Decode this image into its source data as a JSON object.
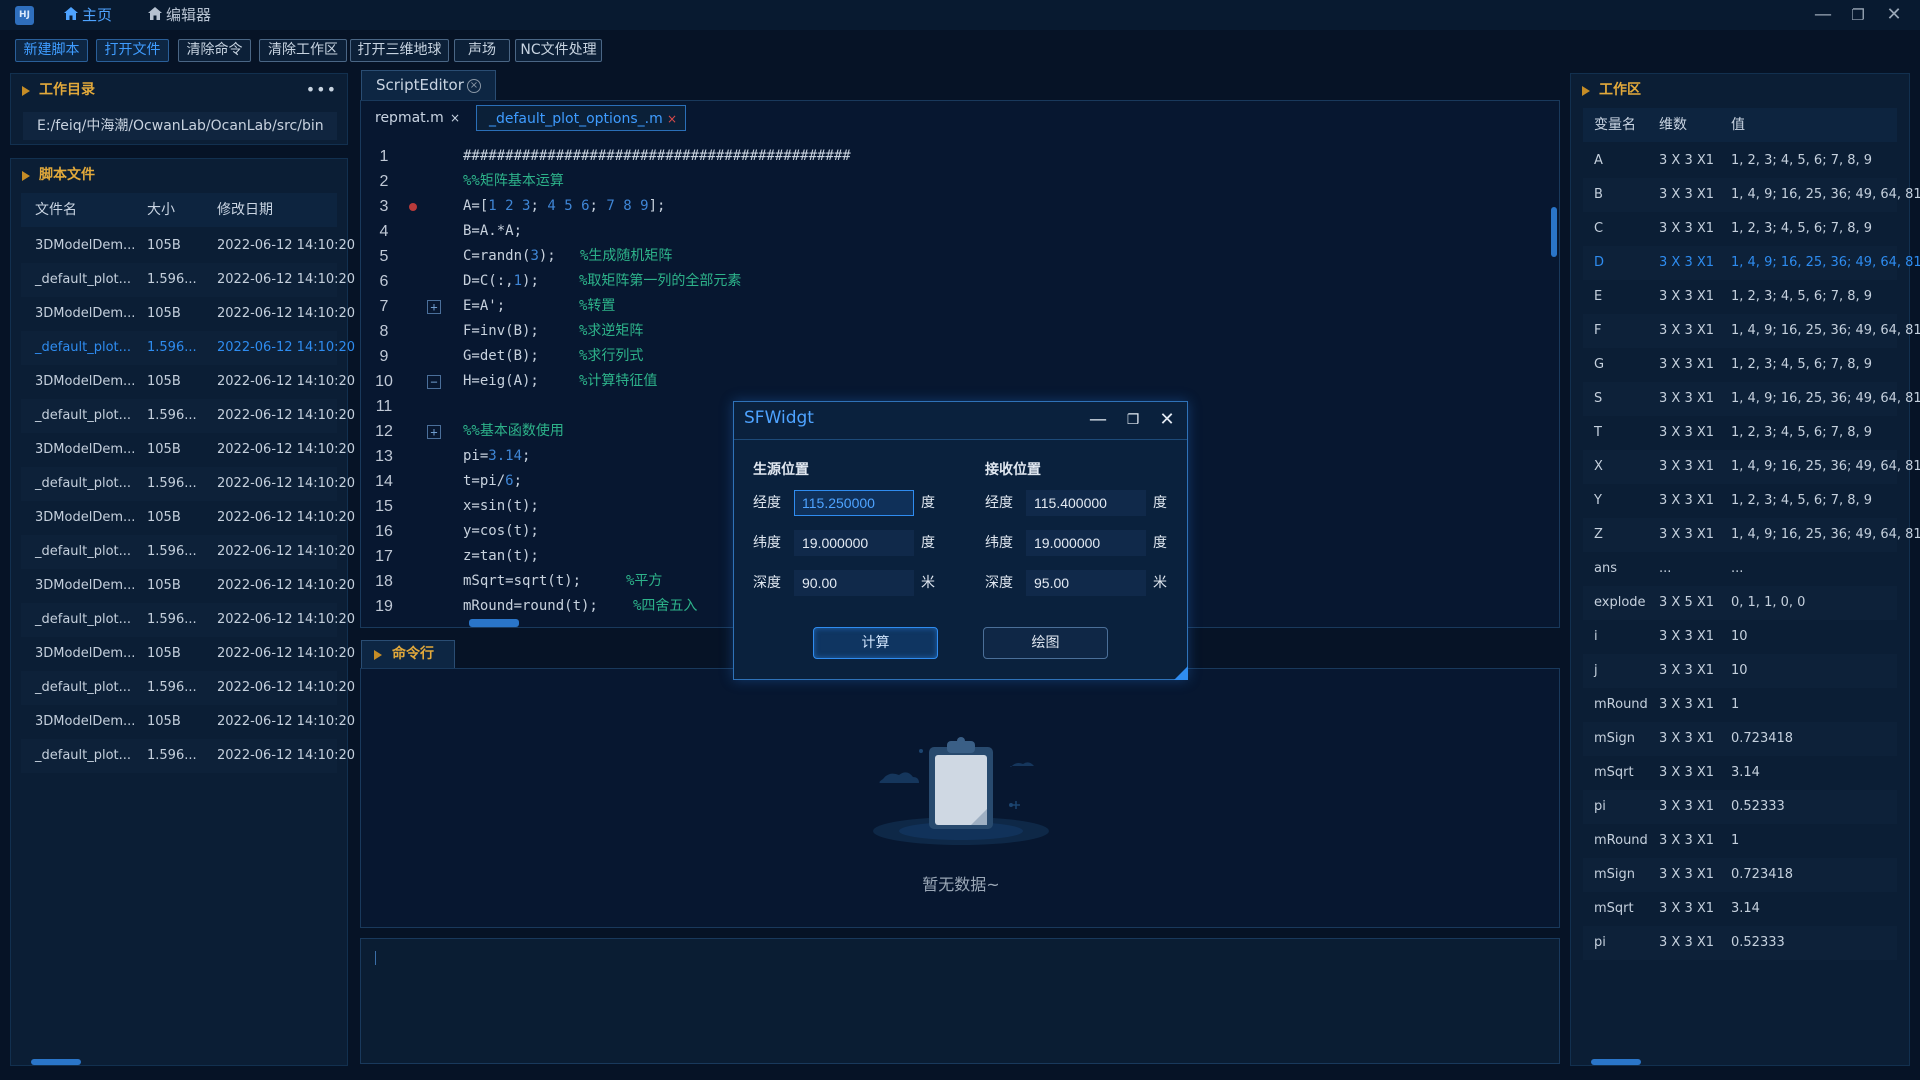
{
  "window": {
    "logo": "HJ",
    "tabs": [
      {
        "label": "主页",
        "icon": "home-icon"
      },
      {
        "label": "编辑器",
        "icon": "home-icon"
      }
    ],
    "controls": {
      "minimize": "—",
      "restore": "❐",
      "close": "✕"
    }
  },
  "toolbar": [
    {
      "label": "新建脚本",
      "primary": true
    },
    {
      "label": "打开文件",
      "primary": true
    },
    {
      "label": "清除命令",
      "primary": false
    },
    {
      "label": "清除工作区",
      "primary": false
    },
    {
      "label": "打开三维地球",
      "primary": false
    },
    {
      "label": "声场",
      "primary": false
    },
    {
      "label": "NC文件处理",
      "primary": false
    }
  ],
  "workdir": {
    "title": "工作目录",
    "path": "E:/feiq/中海潮/OcwanLab/OcanLab/src/bin",
    "more": "•••"
  },
  "scripts": {
    "title": "脚本文件",
    "columns": [
      "文件名",
      "大小",
      "修改日期"
    ],
    "rows": [
      {
        "name": "3DModelDem...",
        "size": "105B",
        "date": "2022-06-12 14:10:20"
      },
      {
        "name": "_default_plot...",
        "size": "1.596...",
        "date": "2022-06-12 14:10:20"
      },
      {
        "name": "3DModelDem...",
        "size": "105B",
        "date": "2022-06-12 14:10:20"
      },
      {
        "name": "_default_plot...",
        "size": "1.596...",
        "date": "2022-06-12 14:10:20"
      },
      {
        "name": "3DModelDem...",
        "size": "105B",
        "date": "2022-06-12 14:10:20"
      },
      {
        "name": "_default_plot...",
        "size": "1.596...",
        "date": "2022-06-12 14:10:20"
      },
      {
        "name": "3DModelDem...",
        "size": "105B",
        "date": "2022-06-12 14:10:20"
      },
      {
        "name": "_default_plot...",
        "size": "1.596...",
        "date": "2022-06-12 14:10:20"
      },
      {
        "name": "3DModelDem...",
        "size": "105B",
        "date": "2022-06-12 14:10:20"
      },
      {
        "name": "_default_plot...",
        "size": "1.596...",
        "date": "2022-06-12 14:10:20"
      },
      {
        "name": "3DModelDem...",
        "size": "105B",
        "date": "2022-06-12 14:10:20"
      },
      {
        "name": "_default_plot...",
        "size": "1.596...",
        "date": "2022-06-12 14:10:20"
      },
      {
        "name": "3DModelDem...",
        "size": "105B",
        "date": "2022-06-12 14:10:20"
      },
      {
        "name": "_default_plot...",
        "size": "1.596...",
        "date": "2022-06-12 14:10:20"
      },
      {
        "name": "3DModelDem...",
        "size": "105B",
        "date": "2022-06-12 14:10:20"
      },
      {
        "name": "_default_plot...",
        "size": "1.596...",
        "date": "2022-06-12 14:10:20"
      }
    ],
    "selected_index": 3
  },
  "editor": {
    "tab_label": "ScriptEditor",
    "files": [
      {
        "label": "repmat.m",
        "close": "×",
        "active": false
      },
      {
        "label": "_default_plot_options_.m",
        "close": "×",
        "active": true
      }
    ],
    "lines": [
      {
        "n": "1",
        "code": "##############################################",
        "comment": "",
        "gutter": ""
      },
      {
        "n": "2",
        "code": "",
        "comment": "%%矩阵基本运算",
        "gutter": ""
      },
      {
        "n": "3",
        "code": "A=[1 2 3; 4 5 6; 7 8 9];",
        "comment": "",
        "gutter": "breakpoint"
      },
      {
        "n": "4",
        "code": "B=A.*A;",
        "comment": "",
        "gutter": ""
      },
      {
        "n": "5",
        "code": "C=randn(3);",
        "comment": "%生成随机矩阵",
        "gutter": ""
      },
      {
        "n": "6",
        "code": "D=C(:,1);",
        "comment": "%取矩阵第一列的全部元素",
        "gutter": ""
      },
      {
        "n": "7",
        "code": "E=A';",
        "comment": "%转置",
        "gutter": "plus"
      },
      {
        "n": "8",
        "code": "F=inv(B);",
        "comment": "%求逆矩阵",
        "gutter": ""
      },
      {
        "n": "9",
        "code": "G=det(B);",
        "comment": "%求行列式",
        "gutter": ""
      },
      {
        "n": "10",
        "code": "H=eig(A);",
        "comment": "%计算特征值",
        "gutter": "minus"
      },
      {
        "n": "11",
        "code": "",
        "comment": "",
        "gutter": ""
      },
      {
        "n": "12",
        "code": "",
        "comment": "%%基本函数使用",
        "gutter": "plus"
      },
      {
        "n": "13",
        "code": "pi=3.14;",
        "comment": "",
        "gutter": ""
      },
      {
        "n": "14",
        "code": "t=pi/6;",
        "comment": "",
        "gutter": ""
      },
      {
        "n": "15",
        "code": "x=sin(t);",
        "comment": "",
        "gutter": ""
      },
      {
        "n": "16",
        "code": "y=cos(t);",
        "comment": "",
        "gutter": ""
      },
      {
        "n": "17",
        "code": "z=tan(t);",
        "comment": "",
        "gutter": ""
      },
      {
        "n": "18",
        "code": "mSqrt=sqrt(t);",
        "comment": "%平方",
        "gutter": ""
      },
      {
        "n": "19",
        "code": "mRound=round(t);",
        "comment": "%四舍五入",
        "gutter": ""
      }
    ]
  },
  "command": {
    "tab_label": "命令行",
    "empty_text": "暂无数据~"
  },
  "workspace": {
    "title": "工作区",
    "columns": [
      "变量名",
      "维数",
      "值"
    ],
    "rows": [
      {
        "name": "A",
        "dim": "3 X 3 X1",
        "value": "1, 2, 3; 4, 5, 6; 7, 8, 9"
      },
      {
        "name": "B",
        "dim": "3 X 3 X1",
        "value": "1, 4, 9; 16, 25, 36; 49, 64, 81"
      },
      {
        "name": "C",
        "dim": "3 X 3 X1",
        "value": "1, 2, 3; 4, 5, 6; 7, 8, 9"
      },
      {
        "name": "D",
        "dim": "3 X 3 X1",
        "value": "1, 4, 9; 16, 25, 36; 49, 64, 81"
      },
      {
        "name": "E",
        "dim": "3 X 3 X1",
        "value": "1, 2, 3; 4, 5, 6; 7, 8, 9"
      },
      {
        "name": "F",
        "dim": "3 X 3 X1",
        "value": "1, 4, 9; 16, 25, 36; 49, 64, 81"
      },
      {
        "name": "G",
        "dim": "3 X 3 X1",
        "value": "1, 2, 3; 4, 5, 6; 7, 8, 9"
      },
      {
        "name": "S",
        "dim": "3 X 3 X1",
        "value": "1, 4, 9; 16, 25, 36; 49, 64, 81"
      },
      {
        "name": "T",
        "dim": "3 X 3 X1",
        "value": "1, 2, 3; 4, 5, 6; 7, 8, 9"
      },
      {
        "name": "X",
        "dim": "3 X 3 X1",
        "value": "1, 4, 9; 16, 25, 36; 49, 64, 81"
      },
      {
        "name": "Y",
        "dim": "3 X 3 X1",
        "value": "1, 2, 3; 4, 5, 6; 7, 8, 9"
      },
      {
        "name": "Z",
        "dim": "3 X 3 X1",
        "value": "1, 4, 9; 16, 25, 36; 49, 64, 81"
      },
      {
        "name": "ans",
        "dim": "...",
        "value": "..."
      },
      {
        "name": "explode",
        "dim": "3 X 5 X1",
        "value": "0, 1, 1, 0, 0"
      },
      {
        "name": "i",
        "dim": "3 X 3 X1",
        "value": "10"
      },
      {
        "name": "j",
        "dim": "3 X 3 X1",
        "value": "10"
      },
      {
        "name": "mRound",
        "dim": "3 X 3 X1",
        "value": "1"
      },
      {
        "name": "mSign",
        "dim": "3 X 3 X1",
        "value": "0.723418"
      },
      {
        "name": "mSqrt",
        "dim": "3 X 3 X1",
        "value": "3.14"
      },
      {
        "name": "pi",
        "dim": "3 X 3 X1",
        "value": "0.52333"
      },
      {
        "name": "mRound",
        "dim": "3 X 3 X1",
        "value": "1"
      },
      {
        "name": "mSign",
        "dim": "3 X 3 X1",
        "value": "0.723418"
      },
      {
        "name": "mSqrt",
        "dim": "3 X 3 X1",
        "value": "3.14"
      },
      {
        "name": "pi",
        "dim": "3 X 3 X1",
        "value": "0.52333"
      }
    ],
    "selected_index": 3
  },
  "dialog": {
    "title": "SFWidgt",
    "source": {
      "title": "生源位置",
      "lon_label": "经度",
      "lon": "115.250000",
      "lat_label": "纬度",
      "lat": "19.000000",
      "depth_label": "深度",
      "depth": "90.00"
    },
    "receiver": {
      "title": "接收位置",
      "lon_label": "经度",
      "lon": "115.400000",
      "lat_label": "纬度",
      "lat": "19.000000",
      "depth_label": "深度",
      "depth": "95.00"
    },
    "unit_degree": "度",
    "unit_meter": "米",
    "calc_label": "计算",
    "plot_label": "绘图"
  }
}
